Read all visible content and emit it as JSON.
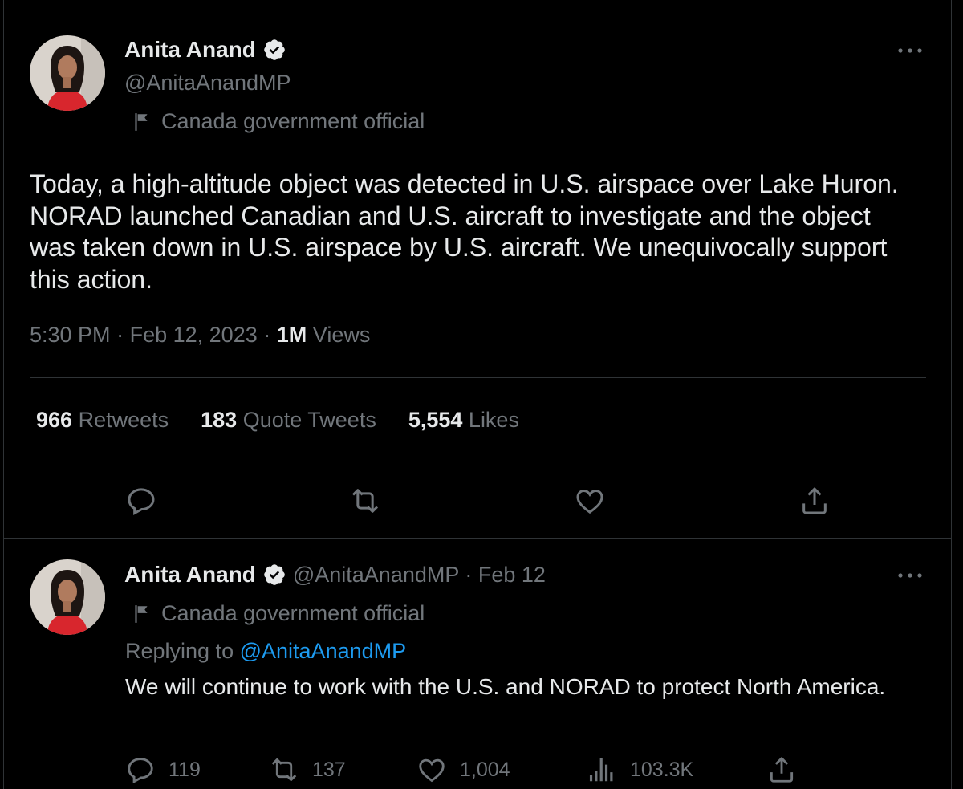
{
  "tweet": {
    "author_name": "Anita Anand",
    "handle": "@AnitaAnandMP",
    "label": "Canada government official",
    "text": "Today, a high-altitude object was detected in U.S. airspace over Lake Huron. NORAD launched Canadian and U.S. aircraft to investigate and the object was taken down in U.S. airspace by U.S. aircraft. We unequivocally support this action.",
    "time": "5:30 PM",
    "date": "Feb 12, 2023",
    "views_count": "1M",
    "views_label": "Views",
    "separator": "·",
    "stats": {
      "retweets_count": "966",
      "retweets_label": "Retweets",
      "quotes_count": "183",
      "quotes_label": "Quote Tweets",
      "likes_count": "5,554",
      "likes_label": "Likes"
    }
  },
  "reply": {
    "author_name": "Anita Anand",
    "handle_date": "@AnitaAnandMP · Feb 12",
    "label": "Canada government official",
    "replying_to_label": "Replying to",
    "replying_to_handle": "@AnitaAnandMP",
    "text": "We will continue to work with the U.S. and NORAD to protect North America.",
    "counts": {
      "replies": "119",
      "retweets": "137",
      "likes": "1,004",
      "views": "103.3K"
    }
  },
  "icons": [
    "verified-badge-icon",
    "government-flag-icon",
    "more-icon",
    "reply-icon",
    "retweet-icon",
    "like-icon",
    "share-icon",
    "views-icon"
  ],
  "colors": {
    "background": "#000000",
    "text": "#e7e9ea",
    "secondary": "#71767b",
    "accent": "#1d9bf0",
    "border": "#2f3336"
  }
}
